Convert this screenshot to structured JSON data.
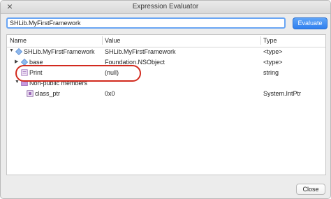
{
  "window": {
    "title": "Expression Evaluator"
  },
  "expression": {
    "value": "SHLib.MyFirstFramework",
    "evaluate_label": "Evaluate"
  },
  "columns": [
    "Name",
    "Value",
    "Type"
  ],
  "rows": [
    {
      "name": "SHLib.MyFirstFramework",
      "value": "SHLib.MyFirstFramework",
      "type": "<type>",
      "icon": "class-icon",
      "disclosure": "▼"
    },
    {
      "name": "base",
      "value": "Foundation.NSObject",
      "type": "<type>",
      "icon": "class-icon",
      "disclosure": "▶"
    },
    {
      "name": "Print",
      "value": "(null)",
      "type": "string",
      "icon": "property-icon",
      "disclosure": ""
    },
    {
      "name": "Non-public members",
      "value": "",
      "type": "",
      "icon": "folder-icon",
      "disclosure": "▼"
    },
    {
      "name": "class_ptr",
      "value": "0x0",
      "type": "System.IntPtr",
      "icon": "field-icon",
      "disclosure": ""
    }
  ],
  "footer": {
    "close_label": "Close"
  },
  "colors": {
    "accent": "#2f7fef",
    "highlight_oval": "#d22a1e",
    "class_icon": "#5a8fd6",
    "folder_icon": "#b07acc"
  }
}
